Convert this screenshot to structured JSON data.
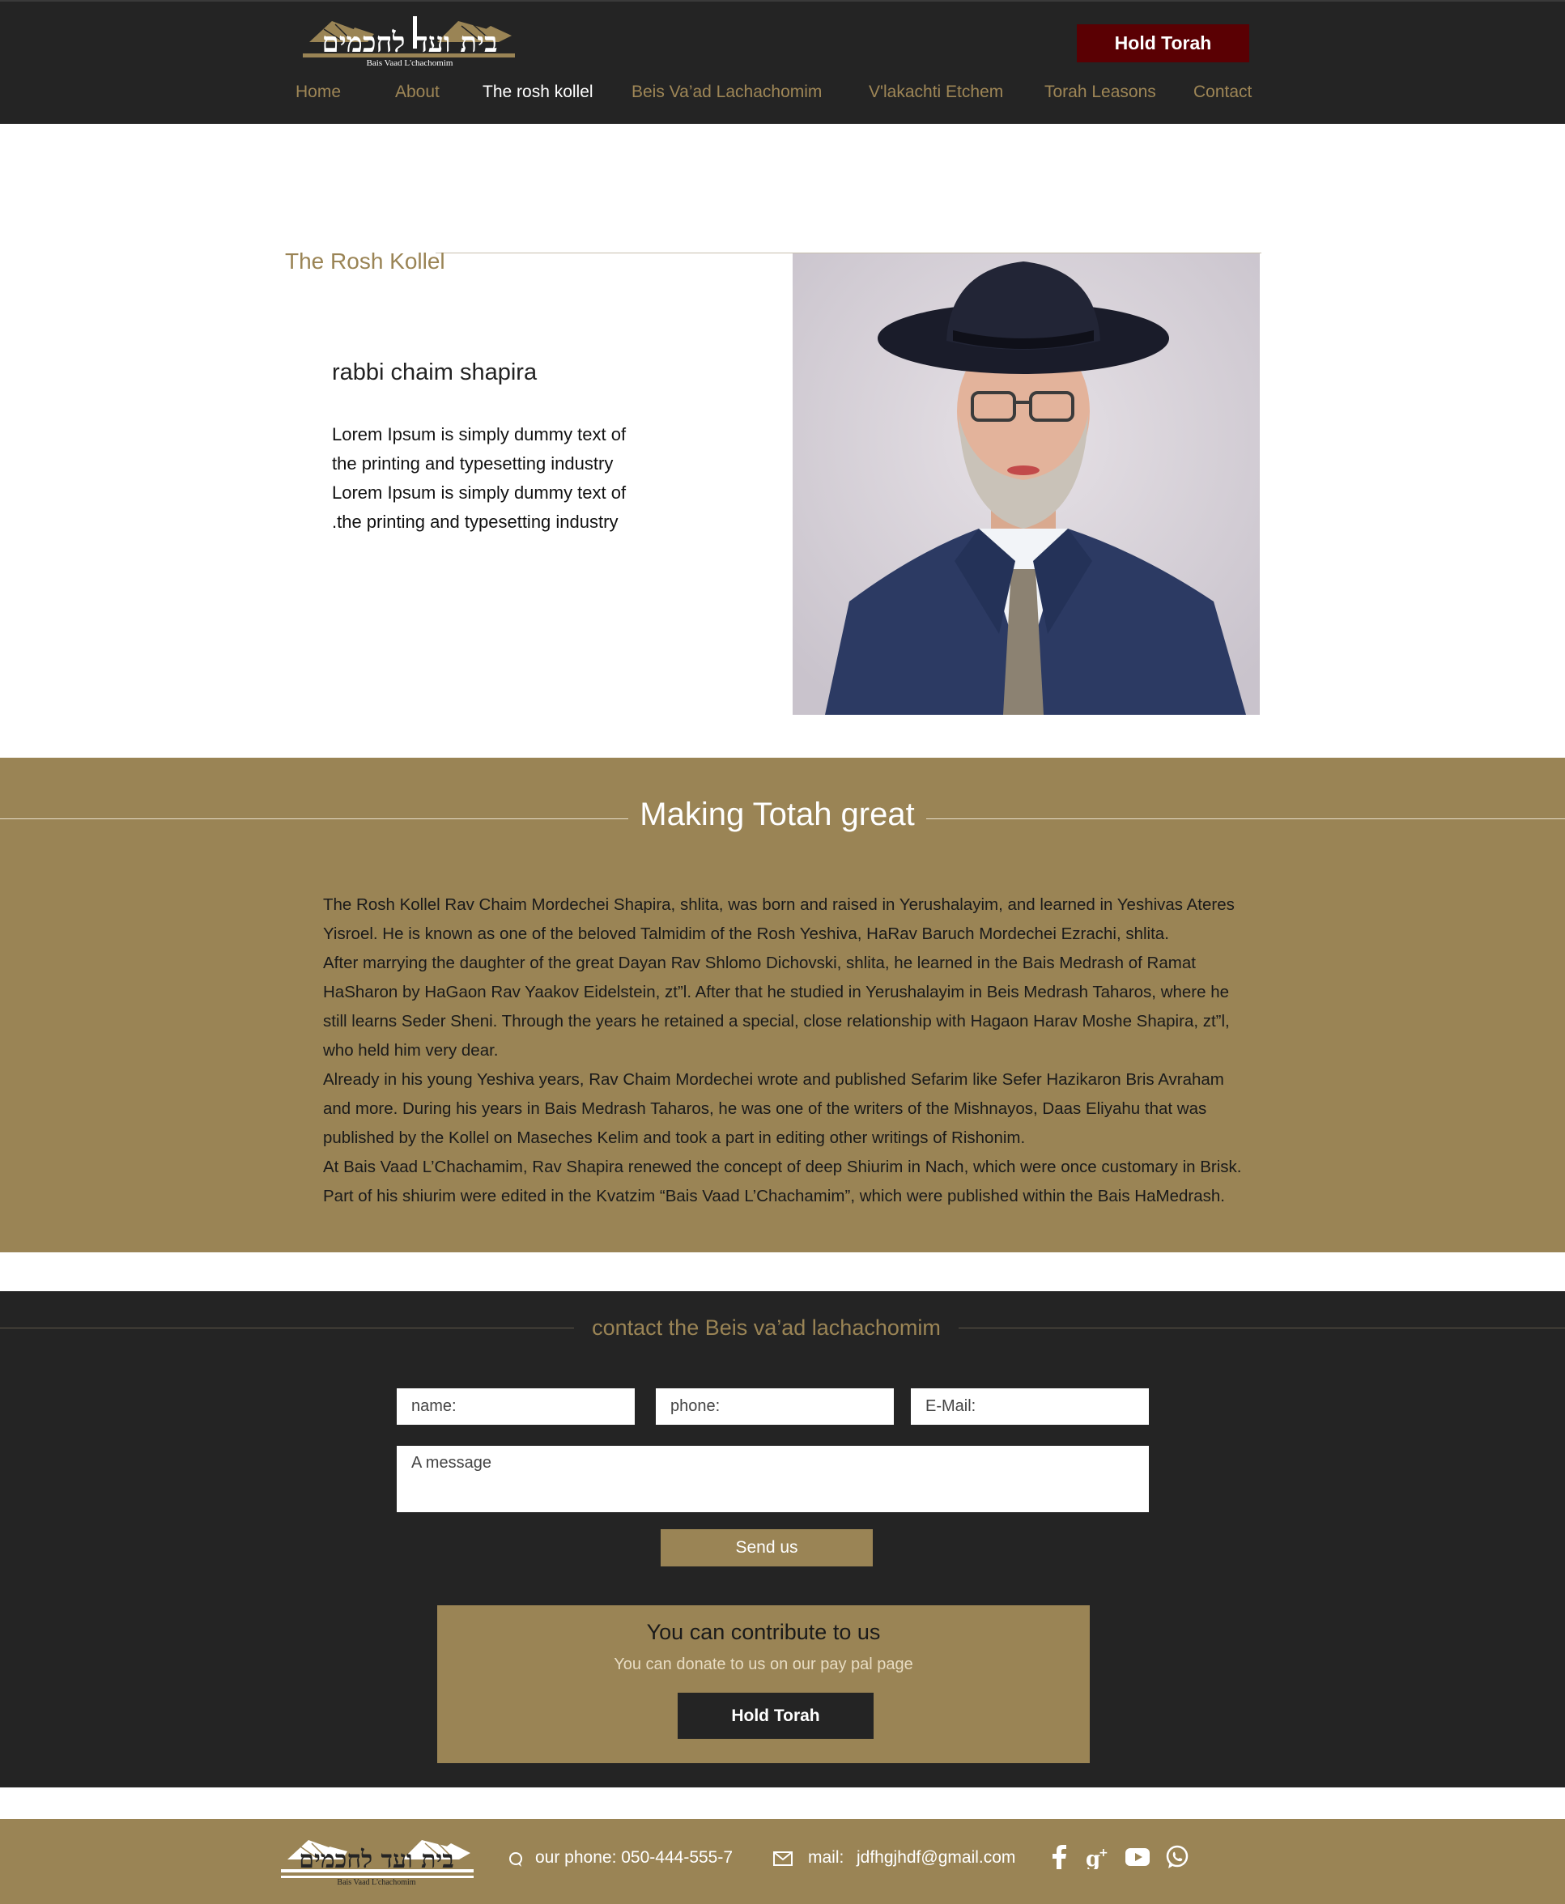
{
  "header": {
    "logo_hebrew": "בית ועד לחכמים",
    "logo_english": "Bais Vaad L'chachomim",
    "hold_torah_label": "Hold  Torah",
    "nav": [
      {
        "label": "Home"
      },
      {
        "label": "About"
      },
      {
        "label": "The rosh kollel",
        "active": true
      },
      {
        "label": "Beis Va’ad Lachachomim"
      },
      {
        "label": "V'lakachti Etchem"
      },
      {
        "label": "Torah Leasons"
      },
      {
        "label": "Contact"
      }
    ]
  },
  "rosh_kollel": {
    "section_title": "The Rosh Kollel",
    "name": "rabbi chaim shapira",
    "bio_lines": [
      "Lorem Ipsum is simply dummy text of",
      "the printing and typesetting industry",
      "Lorem Ipsum is simply dummy text of",
      ".the printing and typesetting industry"
    ]
  },
  "making_torah": {
    "title": "Making Totah great",
    "paragraphs": [
      "The Rosh Kollel Rav Chaim Mordechei Shapira, shlita, was born and raised in Yerushalayim, and learned in Yeshivas Ateres Yisroel. He is known as one of the beloved Talmidim of the Rosh Yeshiva, HaRav Baruch Mordechei Ezrachi, shlita.",
      "After marrying the daughter of the great Dayan Rav Shlomo Dichovski, shlita, he learned in the Bais Medrash of Ramat HaSharon by HaGaon Rav Yaakov Eidelstein, zt”l. After that he studied in Yerushalayim in Beis Medrash Taharos, where he still learns Seder Sheni. Through the years he retained a special, close relationship with Hagaon Harav Moshe Shapira, zt”l, who held him very dear.",
      "Already in his young Yeshiva years, Rav Chaim Mordechei wrote and published Sefarim like Sefer Hazikaron Bris Avraham and more. During his years in Bais Medrash Taharos, he was one of the writers of the Mishnayos, Daas Eliyahu that was published by the Kollel on Maseches Kelim and took a part in editing other writings of Rishonim.",
      "At Bais Vaad L’Chachamim, Rav Shapira renewed the concept of deep Shiurim in Nach, which were once customary in Brisk. Part of his shiurim were edited in the Kvatzim “Bais Vaad L’Chachamim”, which were published within the Bais HaMedrash."
    ]
  },
  "contact": {
    "title": "contact the Beis va’ad lachachomim",
    "name_placeholder": "name:",
    "phone_placeholder": "phone:",
    "email_placeholder": "E-Mail:",
    "message_placeholder": "A message",
    "send_label": "Send us",
    "donate_title": "You can contribute to us",
    "donate_subtitle": "You can donate to us on our pay pal page",
    "donate_button": "Hold Torah"
  },
  "footer": {
    "logo_hebrew": "בית ועד לחכמים",
    "logo_english": "Bais Vaad L'chachomim",
    "phone_label": "our phone: 050-444-555-7",
    "mail_label": "mail:",
    "mail_value": "jdfhgjhdf@gmail.com",
    "social_icons": [
      "facebook-icon",
      "google-plus-icon",
      "youtube-icon",
      "whatsapp-icon"
    ]
  },
  "colors": {
    "dark": "#242424",
    "gold": "#9a8455",
    "maroon": "#5a0003"
  }
}
